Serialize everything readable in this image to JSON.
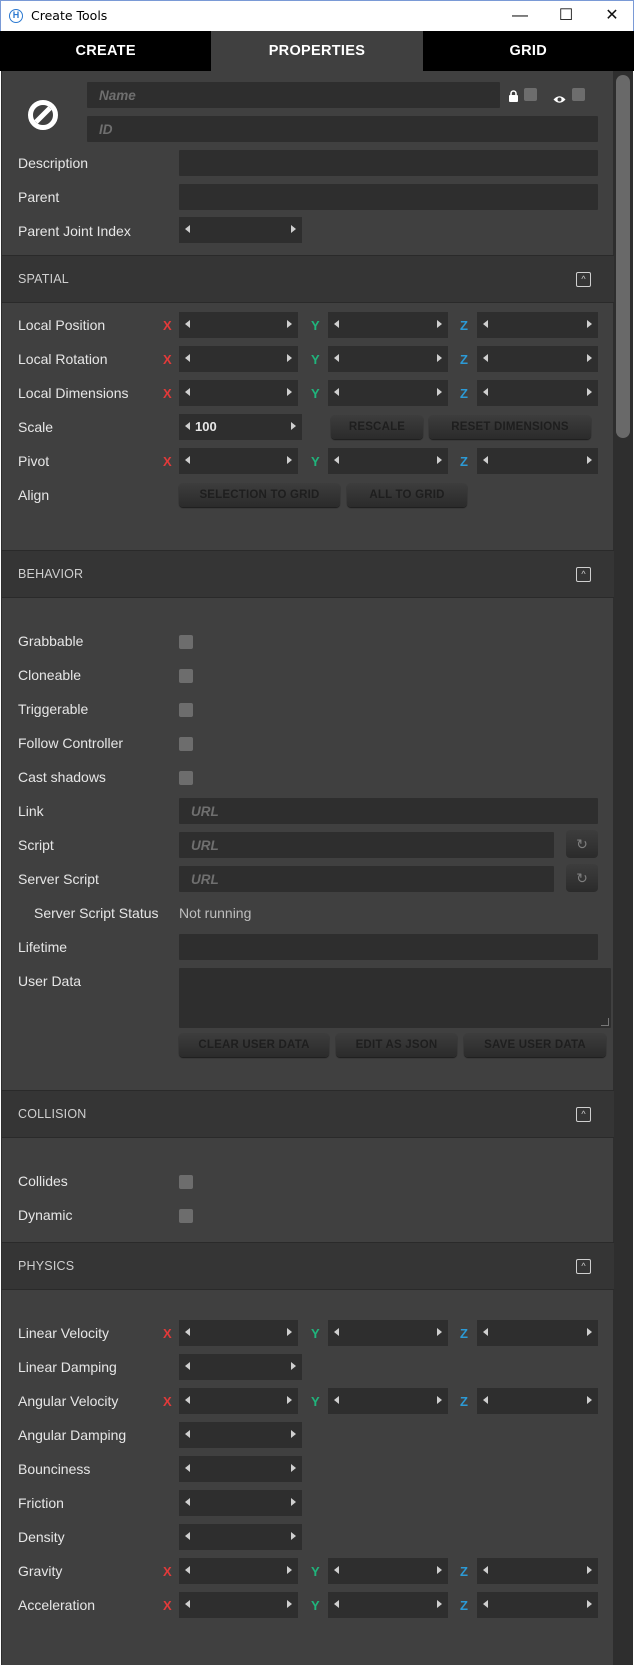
{
  "window": {
    "title": "Create Tools",
    "icon": "hifi-logo-icon",
    "minimize": "—",
    "maximize": "☐",
    "close": "✕"
  },
  "tabs": [
    "CREATE",
    "PROPERTIES",
    "GRID"
  ],
  "active_tab": "PROPERTIES",
  "entity": {
    "icon": "no-entity-icon",
    "name_placeholder": "Name",
    "id_placeholder": "ID",
    "lock_icon": "lock-icon",
    "visible_icon": "eye-icon"
  },
  "general": {
    "description_label": "Description",
    "parent_label": "Parent",
    "parent_joint_label": "Parent Joint Index"
  },
  "axes": {
    "x": "X",
    "y": "Y",
    "z": "Z"
  },
  "spatial": {
    "title": "SPATIAL",
    "local_position": "Local Position",
    "local_rotation": "Local Rotation",
    "local_dimensions": "Local Dimensions",
    "scale": "Scale",
    "scale_value": "100",
    "rescale": "RESCALE",
    "reset_dimensions": "RESET DIMENSIONS",
    "pivot": "Pivot",
    "align": "Align",
    "selection_to_grid": "SELECTION TO GRID",
    "all_to_grid": "ALL TO GRID"
  },
  "behavior": {
    "title": "BEHAVIOR",
    "grabbable": "Grabbable",
    "cloneable": "Cloneable",
    "triggerable": "Triggerable",
    "follow_controller": "Follow Controller",
    "cast_shadows": "Cast shadows",
    "link": "Link",
    "script": "Script",
    "server_script": "Server Script",
    "server_script_status": "Server Script Status",
    "server_script_status_value": "Not running",
    "lifetime": "Lifetime",
    "user_data": "User Data",
    "url_placeholder": "URL",
    "clear_user_data": "CLEAR USER DATA",
    "edit_as_json": "EDIT AS JSON",
    "save_user_data": "SAVE USER DATA"
  },
  "collision": {
    "title": "COLLISION",
    "collides": "Collides",
    "dynamic": "Dynamic"
  },
  "physics": {
    "title": "PHYSICS",
    "linear_velocity": "Linear Velocity",
    "linear_damping": "Linear Damping",
    "angular_velocity": "Angular Velocity",
    "angular_damping": "Angular Damping",
    "bounciness": "Bounciness",
    "friction": "Friction",
    "density": "Density",
    "gravity": "Gravity",
    "acceleration": "Acceleration"
  },
  "colors": {
    "axis_x": "#e23a3a",
    "axis_y": "#1fb57c",
    "axis_z": "#2c9ad6",
    "panel_bg": "#404040",
    "field_bg": "#2e2e2e"
  }
}
